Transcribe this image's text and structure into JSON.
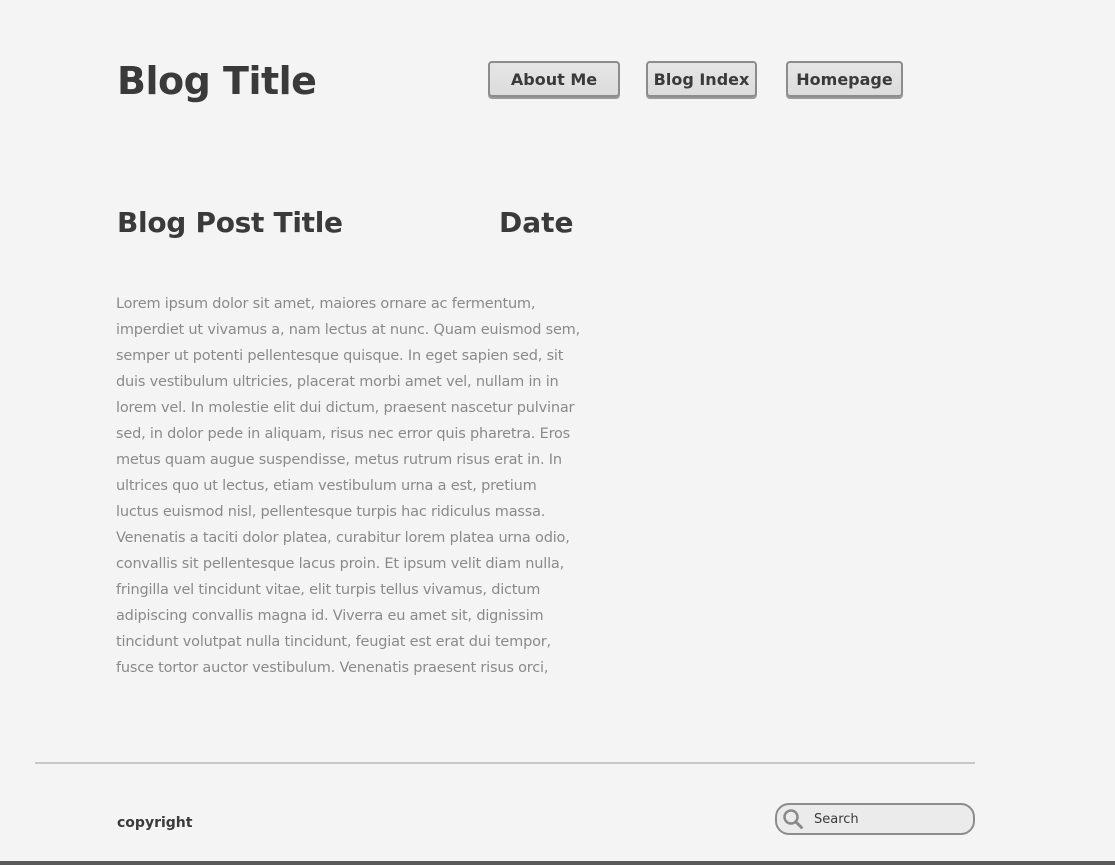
{
  "header": {
    "blog_title": "Blog Title",
    "nav": {
      "about_label": "About Me",
      "index_label": "Blog Index",
      "home_label": "Homepage"
    }
  },
  "post": {
    "title": "Blog Post Title",
    "date": "Date",
    "body": "Lorem ipsum dolor sit amet, maiores ornare ac fermentum, imperdiet ut vivamus a, nam lectus at nunc. Quam euismod sem, semper ut potenti pellentesque quisque. In eget sapien sed, sit duis vestibulum ultricies, placerat morbi amet vel, nullam in in lorem vel. In molestie elit dui dictum, praesent nascetur pulvinar sed, in dolor pede in aliquam, risus nec error quis pharetra. Eros metus quam augue suspendisse, metus rutrum risus erat in.  In ultrices quo ut lectus, etiam vestibulum urna a est, pretium luctus euismod nisl, pellentesque turpis hac ridiculus massa. Venenatis a taciti dolor platea, curabitur lorem platea urna odio, convallis sit pellentesque lacus proin. Et ipsum velit diam nulla, fringilla vel tincidunt vitae, elit turpis tellus vivamus, dictum adipiscing convallis magna id. Viverra eu amet sit, dignissim tincidunt volutpat nulla tincidunt, feugiat est erat dui tempor, fusce tortor auctor vestibulum. Venenatis praesent risus orci,"
  },
  "footer": {
    "copyright": "copyright",
    "search": {
      "placeholder": "Search",
      "icon": "search-icon"
    }
  },
  "colors": {
    "background": "#f4f4f4",
    "heading_text": "#3a3a3a",
    "body_text": "#8a8a8a",
    "button_fill": "#e0e0e0",
    "button_border": "#8c8c8c",
    "divider": "#c9c9c9"
  }
}
